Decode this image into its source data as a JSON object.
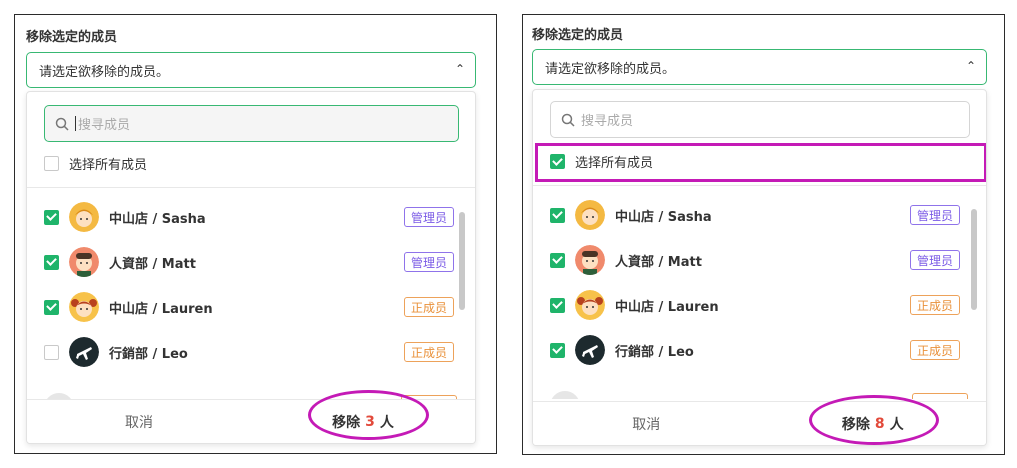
{
  "left": {
    "title": "移除选定的成员",
    "select_placeholder": "请选定欲移除的成员。",
    "search_placeholder": "搜寻成员",
    "select_all_label": "选择所有成员",
    "select_all_checked": false,
    "members": [
      {
        "name": "中山店 / Sasha",
        "role": "管理员",
        "role_type": "admin",
        "checked": true,
        "avatar": "girl-avatar-icon"
      },
      {
        "name": "人資部 / Matt",
        "role": "管理员",
        "role_type": "admin",
        "checked": true,
        "avatar": "man-avatar-icon"
      },
      {
        "name": "中山店 / Lauren",
        "role": "正成员",
        "role_type": "member",
        "checked": true,
        "avatar": "girl-buns-avatar-icon"
      },
      {
        "name": "行銷部 / Leo",
        "role": "正成员",
        "role_type": "member",
        "checked": false,
        "avatar": "airplane-avatar-icon"
      }
    ],
    "cancel_label": "取消",
    "remove_prefix": "移除",
    "remove_count": "3",
    "remove_suffix": "人"
  },
  "right": {
    "title": "移除选定的成员",
    "select_placeholder": "请选定欲移除的成员。",
    "search_placeholder": "搜寻成员",
    "select_all_label": "选择所有成员",
    "select_all_checked": true,
    "members": [
      {
        "name": "中山店 / Sasha",
        "role": "管理员",
        "role_type": "admin",
        "checked": true,
        "avatar": "girl-avatar-icon"
      },
      {
        "name": "人資部 / Matt",
        "role": "管理员",
        "role_type": "admin",
        "checked": true,
        "avatar": "man-avatar-icon"
      },
      {
        "name": "中山店 / Lauren",
        "role": "正成员",
        "role_type": "member",
        "checked": true,
        "avatar": "girl-buns-avatar-icon"
      },
      {
        "name": "行銷部 / Leo",
        "role": "正成员",
        "role_type": "member",
        "checked": true,
        "avatar": "airplane-avatar-icon"
      }
    ],
    "cancel_label": "取消",
    "remove_prefix": "移除",
    "remove_count": "8",
    "remove_suffix": "人"
  },
  "colors": {
    "accent_green": "#1fb46a",
    "highlight_magenta": "#c41ab6",
    "admin_purple": "#7b5be6",
    "member_orange": "#e9913a",
    "count_red": "#e24a3b"
  }
}
